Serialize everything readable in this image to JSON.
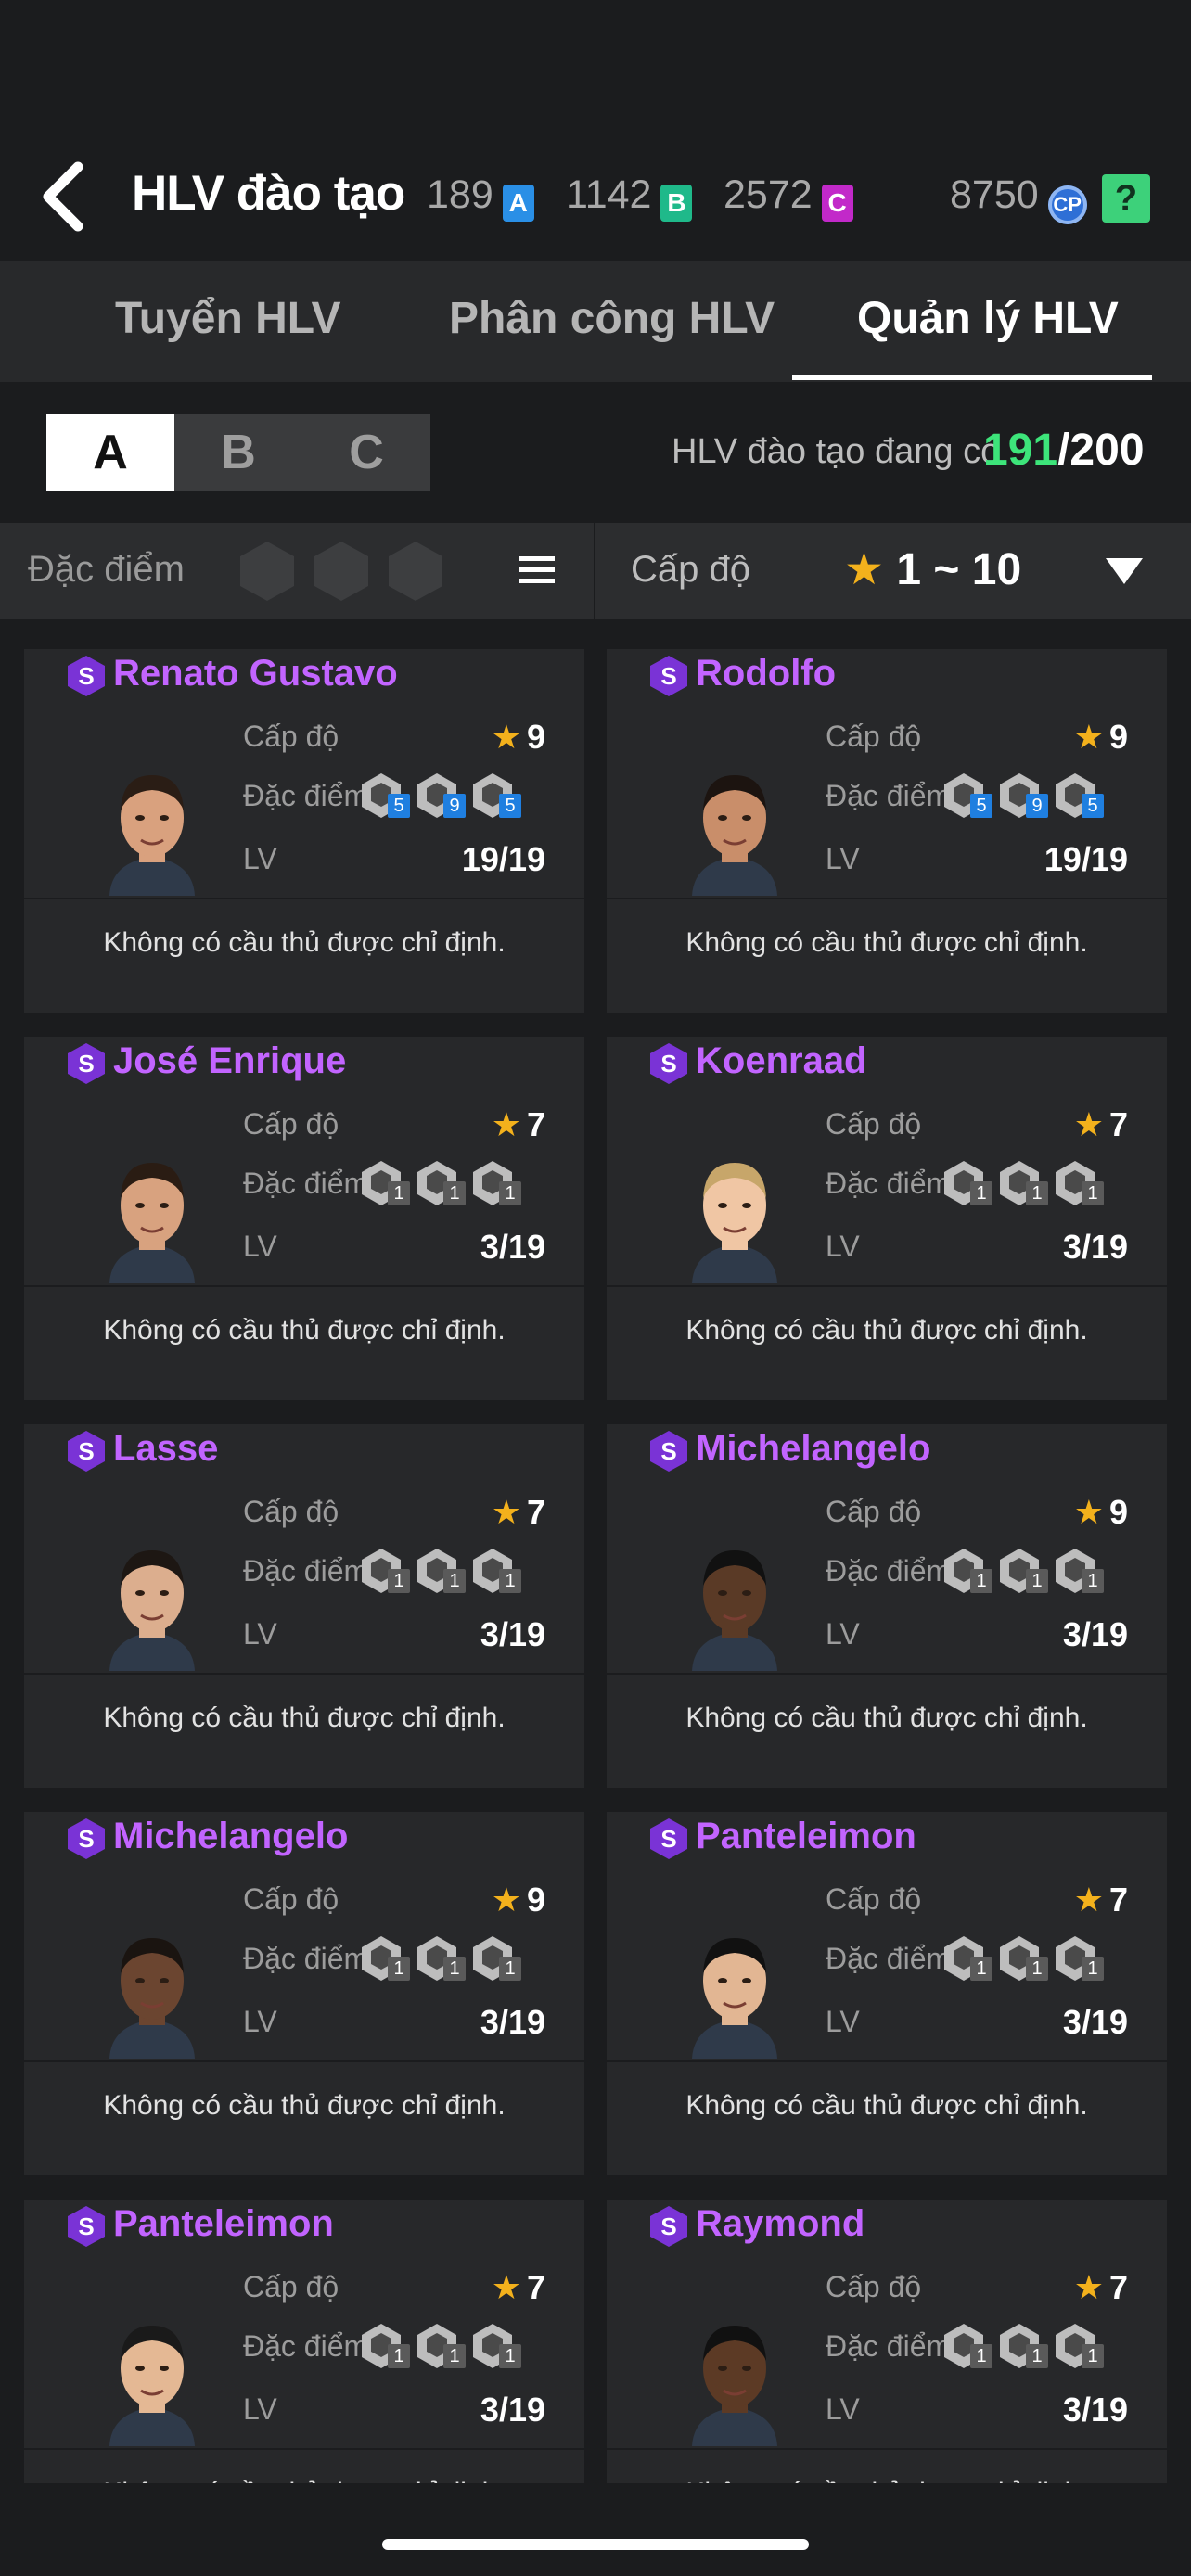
{
  "header": {
    "title": "HLV đào tạo",
    "currencies": [
      {
        "value": "189",
        "badge": "A",
        "color": "#2a8fe6"
      },
      {
        "value": "1142",
        "badge": "B",
        "color": "#1fb98a"
      },
      {
        "value": "2572",
        "badge": "C",
        "color": "#c229c9"
      }
    ],
    "cp_value": "8750",
    "cp_badge": "CP",
    "help_label": "?"
  },
  "tabs": [
    {
      "label": "Tuyển HLV",
      "active": false
    },
    {
      "label": "Phân công HLV",
      "active": false
    },
    {
      "label": "Quản lý HLV",
      "active": true
    }
  ],
  "segments": [
    "A",
    "B",
    "C"
  ],
  "capacity": {
    "label": "HLV đào tạo đang có",
    "current": "191",
    "max": "/200"
  },
  "filters": {
    "trait_label": "Đặc điểm c",
    "level_label": "Cấp độ",
    "level_star": "★",
    "level_range": "1 ~ 10"
  },
  "card_labels": {
    "level": "Cấp độ",
    "traits": "Đặc điểm",
    "lv": "LV",
    "footer": "Không có cầu thủ được chỉ định."
  },
  "coaches": [
    {
      "name": "Renato Gustavo",
      "level": "9",
      "lv": "19/19",
      "traits": [
        "5",
        "9",
        "5"
      ],
      "highlight": true
    },
    {
      "name": "Rodolfo",
      "level": "9",
      "lv": "19/19",
      "traits": [
        "5",
        "9",
        "5"
      ],
      "highlight": true
    },
    {
      "name": "José Enrique",
      "level": "7",
      "lv": "3/19",
      "traits": [
        "1",
        "1",
        "1"
      ],
      "highlight": false
    },
    {
      "name": "Koenraad",
      "level": "7",
      "lv": "3/19",
      "traits": [
        "1",
        "1",
        "1"
      ],
      "highlight": false
    },
    {
      "name": "Lasse",
      "level": "7",
      "lv": "3/19",
      "traits": [
        "1",
        "1",
        "1"
      ],
      "highlight": false
    },
    {
      "name": "Michelangelo",
      "level": "9",
      "lv": "3/19",
      "traits": [
        "1",
        "1",
        "1"
      ],
      "highlight": false
    },
    {
      "name": "Michelangelo",
      "level": "9",
      "lv": "3/19",
      "traits": [
        "1",
        "1",
        "1"
      ],
      "highlight": false
    },
    {
      "name": "Panteleimon",
      "level": "7",
      "lv": "3/19",
      "traits": [
        "1",
        "1",
        "1"
      ],
      "highlight": false
    },
    {
      "name": "Panteleimon",
      "level": "7",
      "lv": "3/19",
      "traits": [
        "1",
        "1",
        "1"
      ],
      "highlight": false
    },
    {
      "name": "Raymond",
      "level": "7",
      "lv": "3/19",
      "traits": [
        "1",
        "1",
        "1"
      ],
      "highlight": false
    }
  ],
  "star": "★",
  "colors": {
    "accent_purple": "#c264ff",
    "green": "#3de47a",
    "star": "#f3b11c"
  }
}
